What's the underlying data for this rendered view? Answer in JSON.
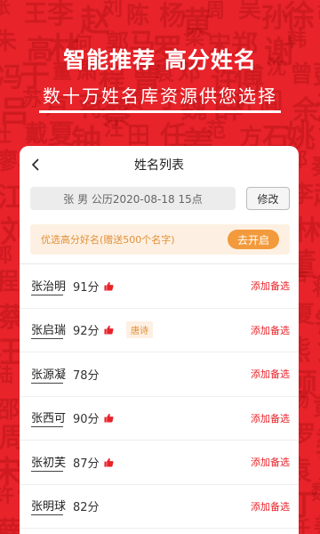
{
  "header": {
    "headline": "智能推荐 高分姓名",
    "subline": "数十万姓名库资源供您选择"
  },
  "nav": {
    "title": "姓名列表"
  },
  "query": {
    "info": "张 男 公历2020-08-18 15点",
    "modify_label": "修改"
  },
  "promo": {
    "text": "优选高分好名(赠送500个名字)",
    "button": "去开启"
  },
  "names": [
    {
      "name": "张治明",
      "score": "91分",
      "thumb": true,
      "tag": ""
    },
    {
      "name": "张启瑞",
      "score": "92分",
      "thumb": true,
      "tag": "唐诗"
    },
    {
      "name": "张源凝",
      "score": "78分",
      "thumb": false,
      "tag": ""
    },
    {
      "name": "张西可",
      "score": "90分",
      "thumb": true,
      "tag": ""
    },
    {
      "name": "张初芙",
      "score": "87分",
      "thumb": true,
      "tag": ""
    },
    {
      "name": "张明球",
      "score": "82分",
      "thumb": false,
      "tag": ""
    }
  ],
  "add_label": "添加备选",
  "colors": {
    "brand": "#e8232a",
    "accent": "#f29a3c",
    "promo_bg": "#fdf0e2"
  },
  "icons": {
    "back": "chevron-left-icon",
    "thumb": "thumbs-up-icon"
  }
}
